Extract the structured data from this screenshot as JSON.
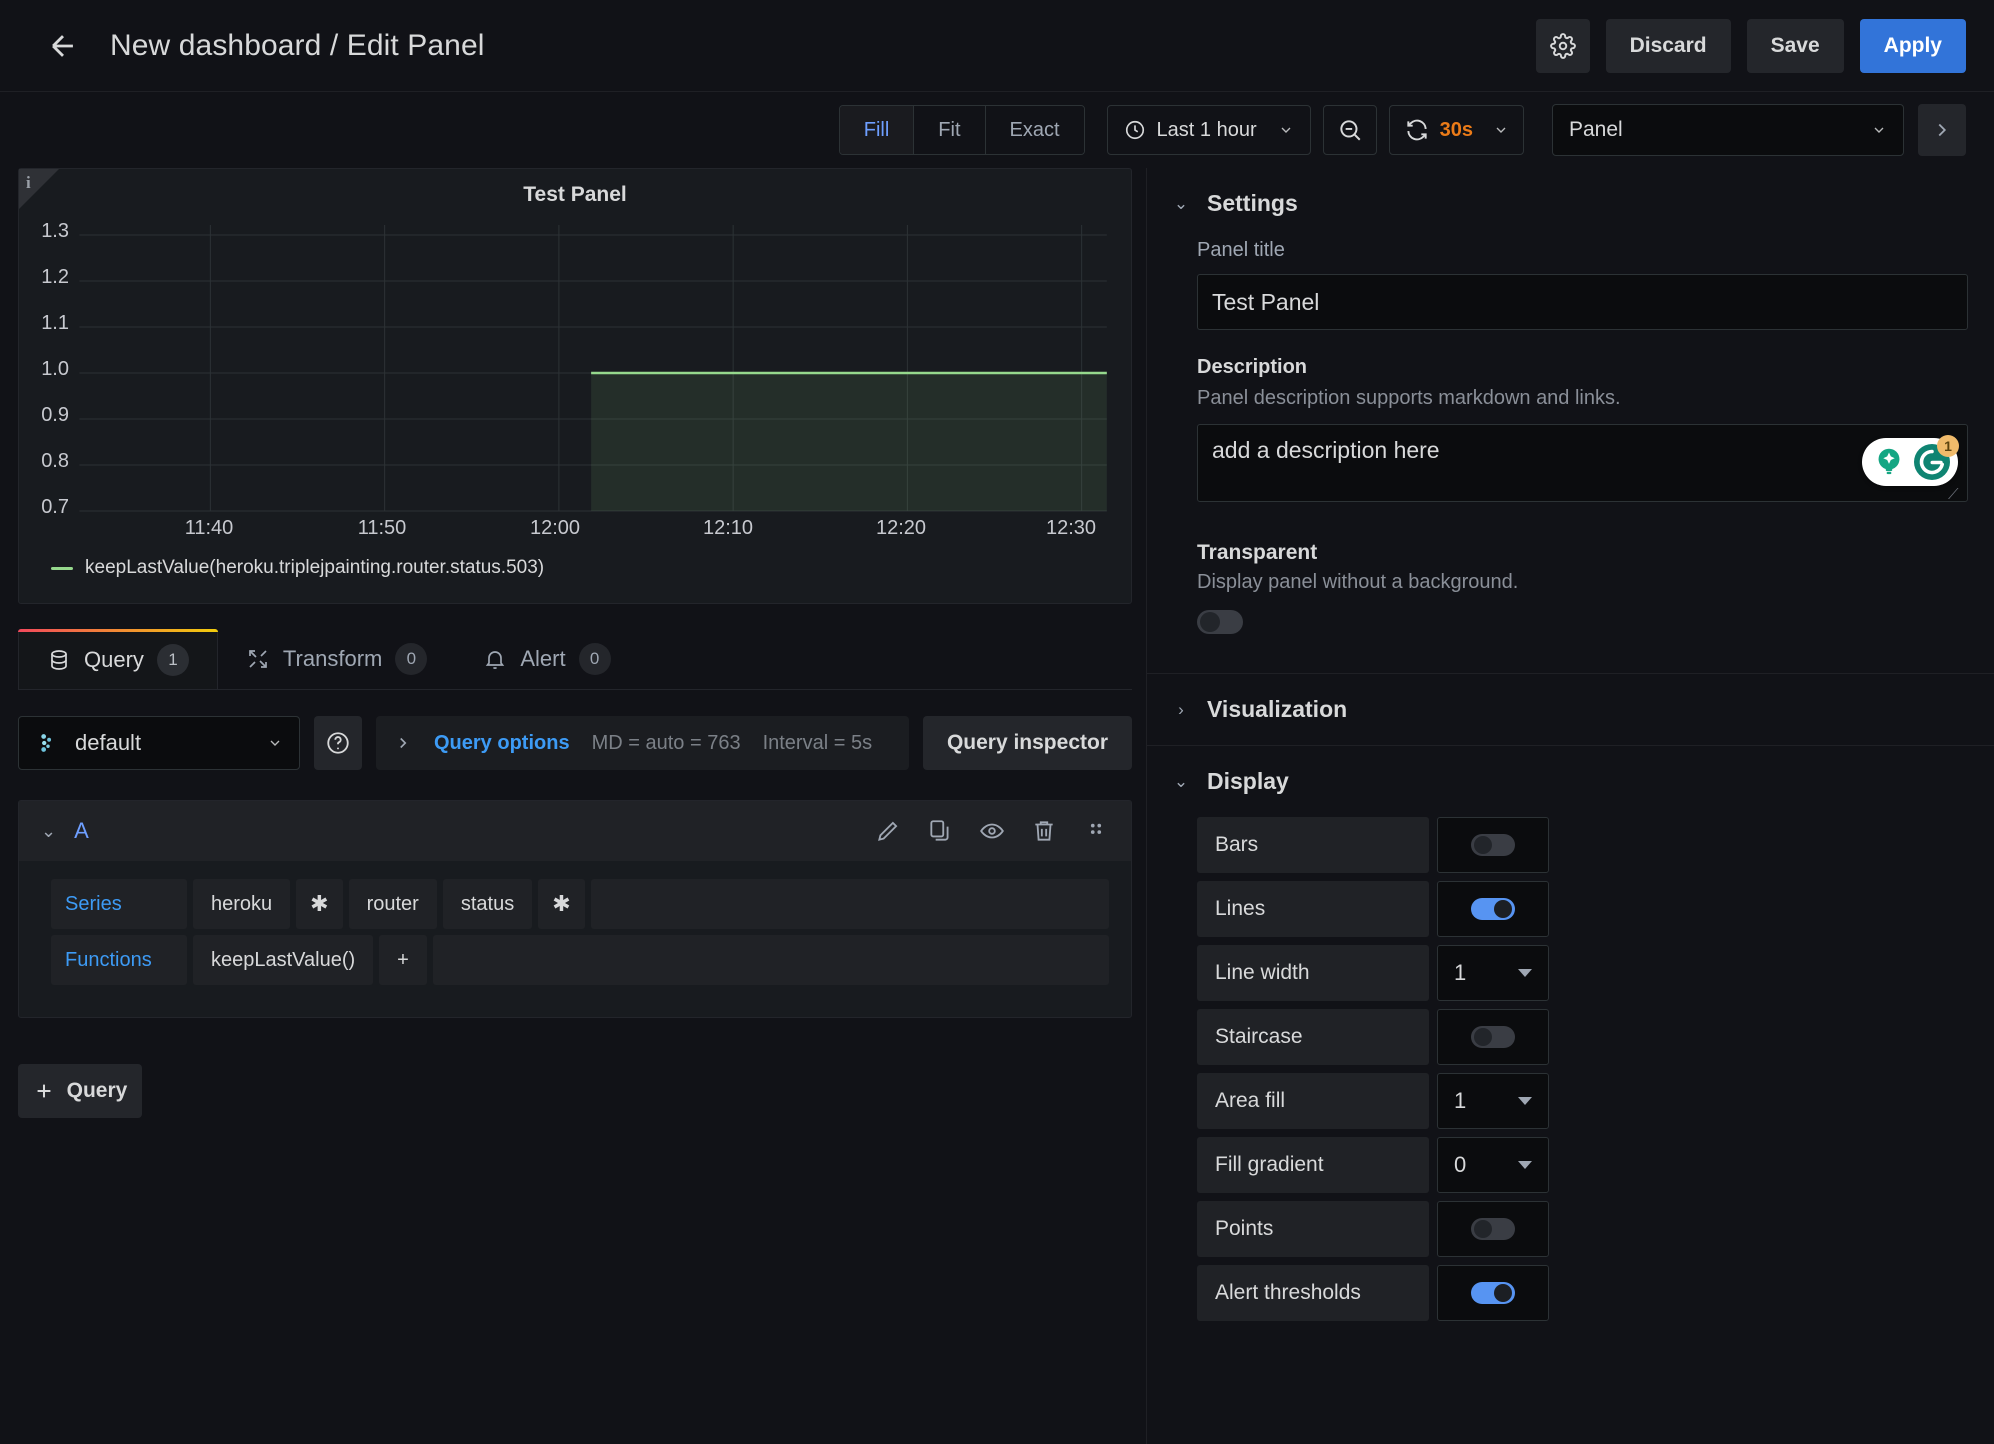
{
  "header": {
    "back_icon": "arrow-left-icon",
    "title": "New dashboard / Edit Panel",
    "gear_icon": "gear-icon",
    "discard_label": "Discard",
    "save_label": "Save",
    "apply_label": "Apply",
    "accent_primary": "#3274d9"
  },
  "toolbar": {
    "sizing_modes": [
      {
        "label": "Fill",
        "active": true
      },
      {
        "label": "Fit",
        "active": false
      },
      {
        "label": "Exact",
        "active": false
      }
    ],
    "time_icon": "clock-icon",
    "time_range": "Last 1 hour",
    "zoom_out_icon": "zoom-out-icon",
    "refresh_icon": "refresh-icon",
    "refresh_interval": "30s",
    "refresh_color": "#eb7b18",
    "panel_selector": "Panel",
    "collapse_icon": "chevron-right-icon"
  },
  "panel": {
    "info_icon": "info-icon",
    "title": "Test Panel",
    "legend": "keepLastValue(heroku.triplejpainting.router.status.503)",
    "series_color": "#96d98d"
  },
  "chart_data": {
    "type": "line",
    "title": "Test Panel",
    "xlabel": "",
    "ylabel": "",
    "ylim": [
      0.65,
      1.35
    ],
    "yticks": [
      "1.3",
      "1.2",
      "1.1",
      "1.0",
      "0.9",
      "0.8",
      "0.7"
    ],
    "ytick_values": [
      1.3,
      1.2,
      1.1,
      1.0,
      0.9,
      0.8,
      0.7
    ],
    "xticks": [
      "11:40",
      "11:50",
      "12:00",
      "12:10",
      "12:20",
      "12:30"
    ],
    "grid": true,
    "legend_position": "bottom-left",
    "area_fill": true,
    "series": [
      {
        "name": "keepLastValue(heroku.triplejpainting.router.status.503)",
        "color": "#96d98d",
        "x": [
          "12:01",
          "12:05",
          "12:10",
          "12:15",
          "12:20",
          "12:25",
          "12:30"
        ],
        "values": [
          1.0,
          1.0,
          1.0,
          1.0,
          1.0,
          1.0,
          1.0
        ]
      }
    ]
  },
  "tabs": [
    {
      "label": "Query",
      "badge": "1",
      "icon": "database-icon",
      "active": true
    },
    {
      "label": "Transform",
      "badge": "0",
      "icon": "transform-icon",
      "active": false
    },
    {
      "label": "Alert",
      "badge": "0",
      "icon": "bell-icon",
      "active": false
    }
  ],
  "query": {
    "datasource_icon": "datasource-icon",
    "datasource": "default",
    "help_icon": "question-circle-icon",
    "expand_icon": "chevron-right-icon",
    "options_label": "Query options",
    "max_data_points": "MD = auto = 763",
    "interval": "Interval = 5s",
    "inspector_label": "Query inspector",
    "add_query_label": "Query",
    "add_icon": "plus-icon",
    "row": {
      "collapse_icon": "chevron-down-icon",
      "ref_id": "A",
      "actions": [
        "pencil-icon",
        "copy-icon",
        "eye-icon",
        "trash-icon",
        "drag-handle-icon"
      ],
      "series_label": "Series",
      "series_segments": [
        "heroku",
        "✱",
        "router",
        "status",
        "✱"
      ],
      "functions_label": "Functions",
      "functions": [
        "keepLastValue()"
      ],
      "add_function_label": "+"
    }
  },
  "options": {
    "settings": {
      "title": "Settings",
      "collapsed": false,
      "panel_title_label": "Panel title",
      "panel_title_value": "Test Panel",
      "description_label": "Description",
      "description_help": "Panel description supports markdown and links.",
      "description_value": "add a description here",
      "transparent_label": "Transparent",
      "transparent_desc": "Display panel without a background.",
      "transparent_on": false,
      "grammarly_badge": "1"
    },
    "visualization": {
      "title": "Visualization",
      "collapsed": true
    },
    "display": {
      "title": "Display",
      "collapsed": false,
      "rows": [
        {
          "label": "Bars",
          "type": "toggle",
          "value": false
        },
        {
          "label": "Lines",
          "type": "toggle",
          "value": true
        },
        {
          "label": "Line width",
          "type": "select",
          "value": "1"
        },
        {
          "label": "Staircase",
          "type": "toggle",
          "value": false
        },
        {
          "label": "Area fill",
          "type": "select",
          "value": "1"
        },
        {
          "label": "Fill gradient",
          "type": "select",
          "value": "0"
        },
        {
          "label": "Points",
          "type": "toggle",
          "value": false
        },
        {
          "label": "Alert thresholds",
          "type": "toggle",
          "value": true
        }
      ]
    }
  }
}
